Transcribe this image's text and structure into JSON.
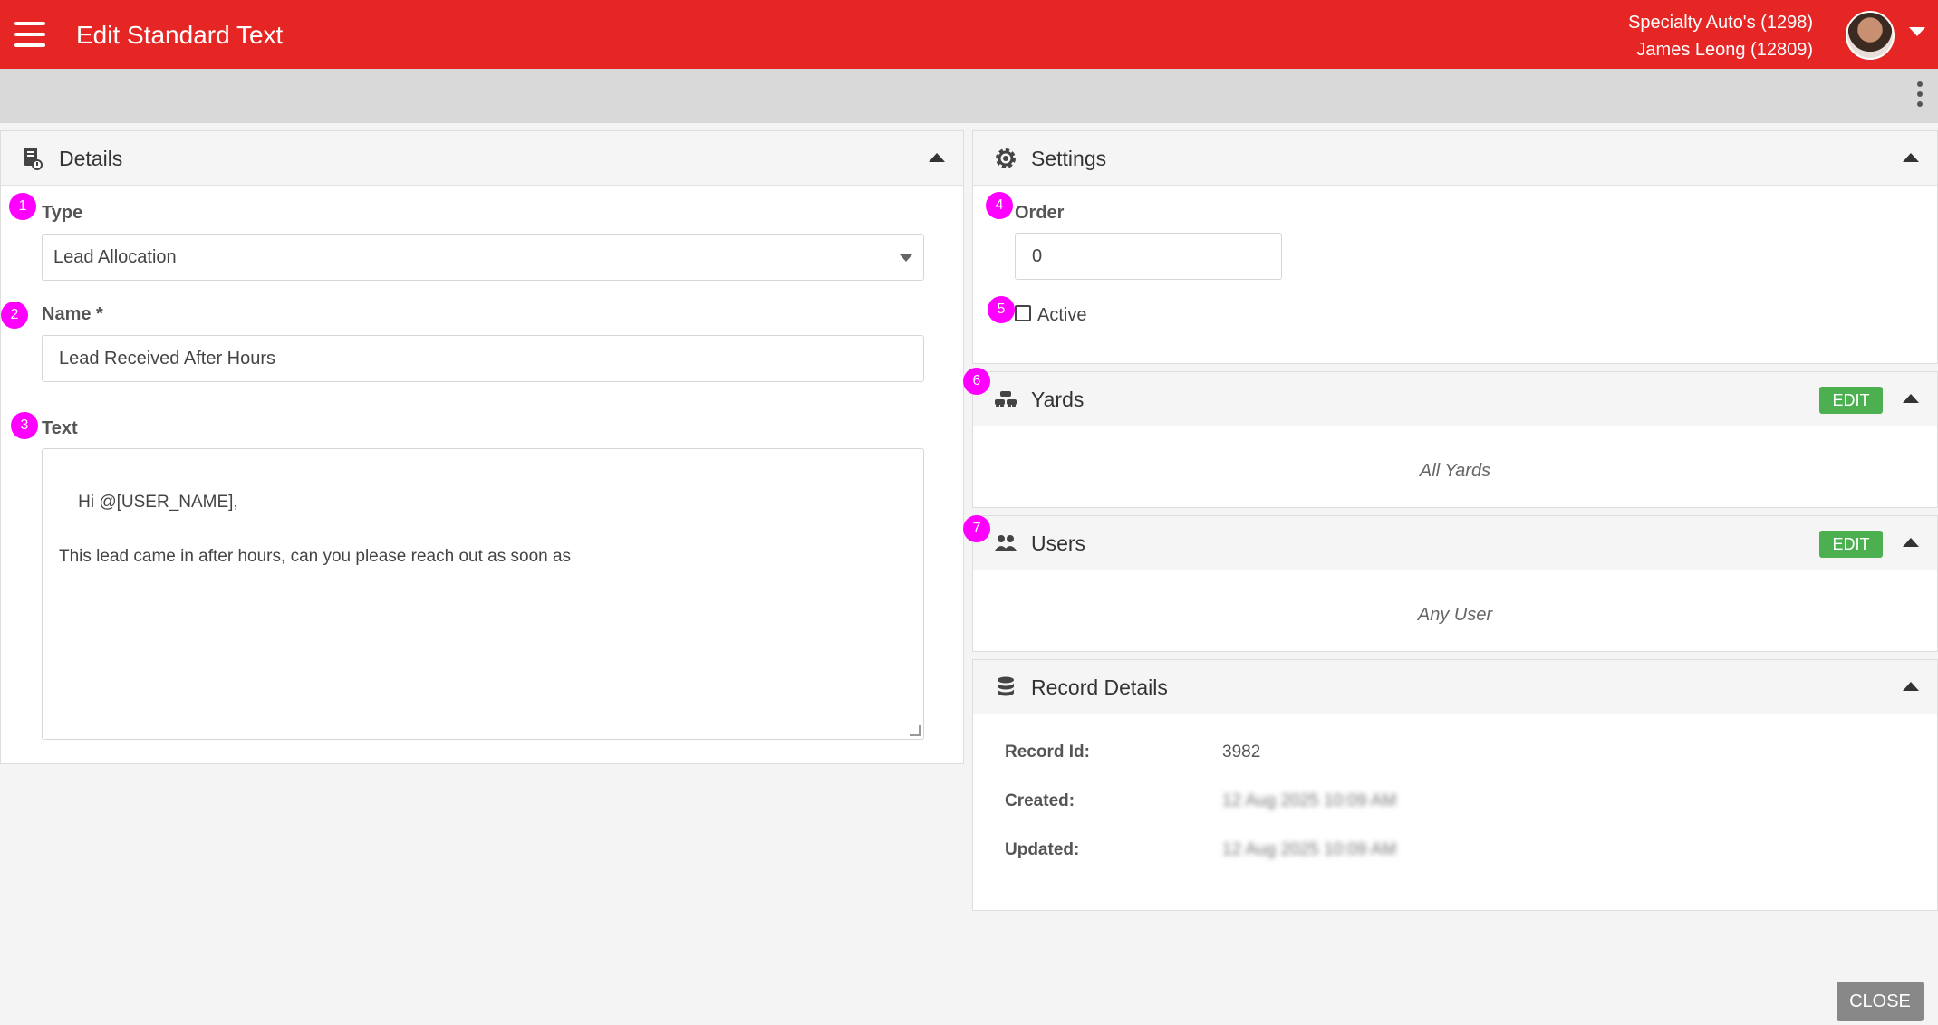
{
  "header": {
    "title": "Edit Standard Text",
    "account_line1": "Specialty Auto's (1298)",
    "account_line2": "James Leong (12809)",
    "accent_color": "#e52624"
  },
  "details": {
    "title": "Details",
    "type_label": "Type",
    "type_value": "Lead Allocation",
    "name_label": "Name *",
    "name_value": "Lead Received After Hours",
    "text_label": "Text",
    "text_value": "Hi @[USER_NAME],\n\nThis lead came in after hours, can you please reach out as soon as"
  },
  "settings": {
    "title": "Settings",
    "order_label": "Order",
    "order_value": "0",
    "active_label": "Active",
    "active_checked": false
  },
  "yards": {
    "title": "Yards",
    "edit_label": "EDIT",
    "value": "All Yards",
    "edit_color": "#4caf50"
  },
  "users": {
    "title": "Users",
    "edit_label": "EDIT",
    "value": "Any User"
  },
  "record": {
    "title": "Record Details",
    "id_label": "Record Id:",
    "id_value": "3982",
    "created_label": "Created:",
    "created_value": "12 Aug 2025 10:09 AM",
    "updated_label": "Updated:",
    "updated_value": "12 Aug 2025 10:09 AM"
  },
  "badges": [
    "1",
    "2",
    "3",
    "4",
    "5",
    "6",
    "7"
  ],
  "footer": {
    "close_label": "CLOSE"
  },
  "badge_color": "#ff00ff"
}
